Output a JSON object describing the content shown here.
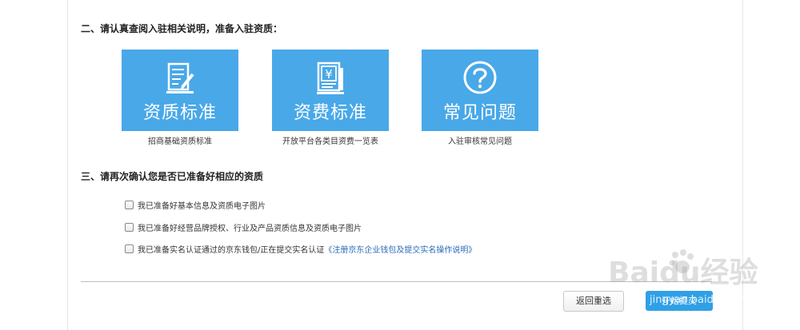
{
  "section2": {
    "title": "二、请认真查阅入驻相关说明，准备入驻资质："
  },
  "cards": [
    {
      "title": "资质标准",
      "subtitle": "招商基础资质标准",
      "icon": "document-pen-icon"
    },
    {
      "title": "资费标准",
      "subtitle": "开放平台各类目资费一览表",
      "icon": "yen-document-icon"
    },
    {
      "title": "常见问题",
      "subtitle": "入驻审核常见问题",
      "icon": "question-circle-icon"
    }
  ],
  "section3": {
    "title": "三、请再次确认您是否已准备好相应的资质"
  },
  "checks": [
    {
      "label": "我已准备好基本信息及资质电子图片"
    },
    {
      "label": "我已准备好经营品牌授权、行业及产品资质信息及资质电子图片"
    },
    {
      "label": "我已准备实名认证通过的京东钱包/正在提交实名认证",
      "link": "《注册京东企业钱包及提交实名操作说明》"
    }
  ],
  "buttons": {
    "reset": "返回重选",
    "start": "开始提交"
  },
  "watermark": {
    "text": "Baidu经验",
    "url": "jingyan.baidu.com"
  },
  "colors": {
    "card_bg": "#49a8e8",
    "primary_button": "#2fa0e6",
    "link": "#2a6db5"
  }
}
